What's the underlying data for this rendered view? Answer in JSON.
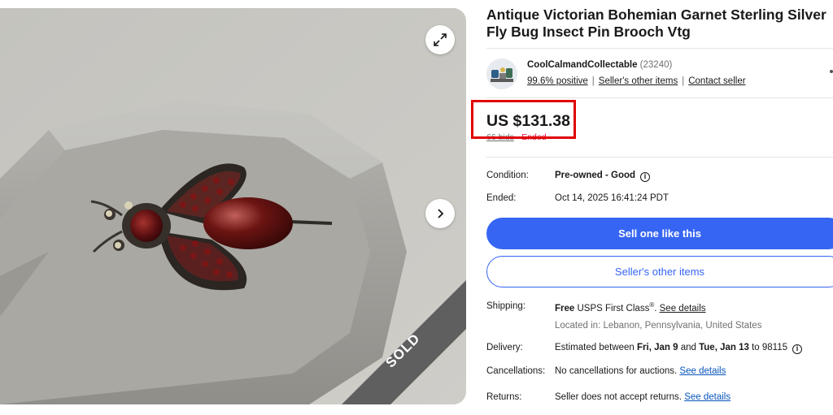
{
  "listing": {
    "title": "Antique Victorian Bohemian Garnet Sterling Silver Fly Bug Insect Pin Brooch Vtg",
    "sold_label": "SOLD"
  },
  "gallery": {
    "expand_icon": "expand-icon",
    "next_icon": "chevron-right-icon"
  },
  "seller": {
    "name": "CoolCalmandCollectable",
    "feedback_count": "(23240)",
    "positive": "99.6% positive",
    "other_items_link": "Seller's other items",
    "contact_link": "Contact seller"
  },
  "price": {
    "amount": "US $131.38",
    "bids": "66 bids",
    "separator": "·",
    "status": "Ended",
    "highlight_color": "#e00000"
  },
  "details": {
    "condition_label": "Condition:",
    "condition_value": "Pre-owned - Good",
    "ended_label": "Ended:",
    "ended_value": "Oct 14, 2025 16:41:24 PDT"
  },
  "actions": {
    "sell_one": "Sell one like this",
    "other_items": "Seller's other items",
    "primary_color": "#3665f3"
  },
  "shipping": {
    "label": "Shipping:",
    "free": "Free",
    "service": "USPS First Class",
    "reg": "®",
    "period": ".",
    "details_link": "See details",
    "location": "Located in: Lebanon, Pennsylvania, United States"
  },
  "delivery": {
    "label": "Delivery:",
    "prefix": "Estimated between",
    "start": "Fri, Jan 9",
    "and": "and",
    "end": "Tue, Jan 13",
    "to": "to 98115"
  },
  "cancellations": {
    "label": "Cancellations:",
    "text": "No cancellations for auctions.",
    "link": "See details"
  },
  "returns": {
    "label": "Returns:",
    "text": "Seller does not accept returns.",
    "link": "See details"
  }
}
